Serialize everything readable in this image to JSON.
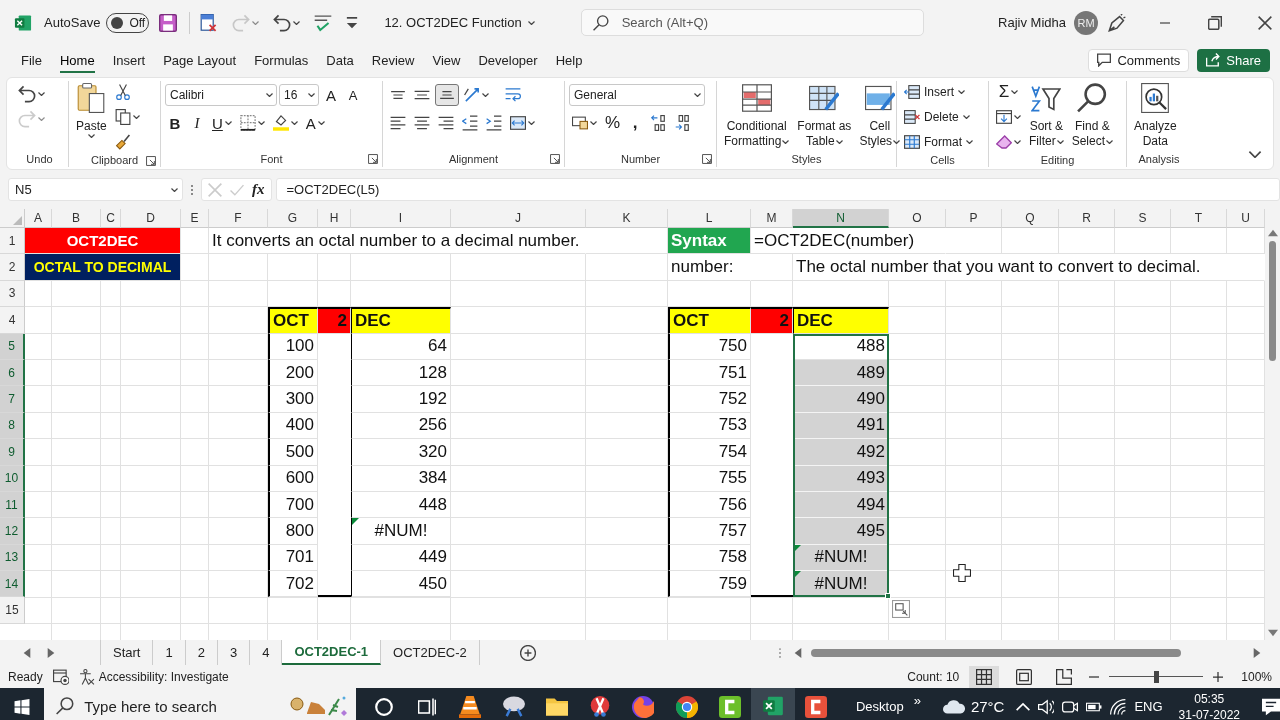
{
  "title_bar": {
    "autosave_label": "AutoSave",
    "autosave_state": "Off",
    "autosave_on": false,
    "file_name": "12. OCT2DEC Function",
    "search_placeholder": "Search (Alt+Q)",
    "user_name": "Rajiv Midha",
    "user_initials": "RM"
  },
  "menu_tabs": [
    {
      "label": "File",
      "selected": false
    },
    {
      "label": "Home",
      "selected": true
    },
    {
      "label": "Insert",
      "selected": false
    },
    {
      "label": "Page Layout",
      "selected": false
    },
    {
      "label": "Formulas",
      "selected": false
    },
    {
      "label": "Data",
      "selected": false
    },
    {
      "label": "Review",
      "selected": false
    },
    {
      "label": "View",
      "selected": false
    },
    {
      "label": "Developer",
      "selected": false
    },
    {
      "label": "Help",
      "selected": false
    }
  ],
  "comments_button": "Comments",
  "share_button": "Share",
  "ribbon": {
    "paste": "Paste",
    "font_name": "Calibri",
    "font_size": "16",
    "grow_font": "A",
    "shrink_font": "A",
    "bold": "B",
    "italic": "I",
    "underline": "U",
    "font_color": "A",
    "number_format": "General",
    "percent": "%",
    "comma": ",",
    "conditional_formatting": [
      "Conditional",
      "Formatting"
    ],
    "format_as_table": [
      "Format as",
      "Table"
    ],
    "cell_styles": [
      "Cell",
      "Styles"
    ],
    "insert": "Insert",
    "delete": "Delete",
    "format": "Format",
    "autosum": "Σ",
    "sort_filter": [
      "Sort &",
      "Filter"
    ],
    "find_select": [
      "Find &",
      "Select"
    ],
    "analyze_data": [
      "Analyze",
      "Data"
    ],
    "groups": [
      "Undo",
      "Clipboard",
      "Font",
      "Alignment",
      "Number",
      "Styles",
      "Cells",
      "Editing",
      "Analysis"
    ]
  },
  "formula_bar": {
    "name_box": "N5",
    "function_label": "fx",
    "formula": "=OCT2DEC(L5)"
  },
  "sheet": {
    "columns": [
      "A",
      "B",
      "C",
      "D",
      "E",
      "F",
      "G",
      "H",
      "I",
      "J",
      "K",
      "L",
      "M",
      "N",
      "O",
      "P",
      "Q",
      "R",
      "S",
      "T",
      "U"
    ],
    "rows": [
      "1",
      "2",
      "3",
      "4",
      "5",
      "6",
      "7",
      "8",
      "9",
      "10",
      "11",
      "12",
      "13",
      "14",
      "15"
    ],
    "title": {
      "name": "OCT2DEC",
      "subtitle": "OCTAL TO DECIMAL"
    },
    "description": "It converts an octal number to a decimal number.",
    "syntax": {
      "label": "Syntax",
      "formula": "=OCT2DEC(number)",
      "argument": "number:",
      "argument_description": "The octal number that you want to convert to decimal."
    },
    "tables": [
      {
        "headers": [
          {
            "text": "OCT",
            "color": "#ffff00"
          },
          {
            "text": "2",
            "color": "#ff0000"
          },
          {
            "text": "DEC",
            "color": "#ffff00"
          }
        ],
        "rows": [
          {
            "octal": "100",
            "decimal": "64",
            "error": false,
            "selected": false
          },
          {
            "octal": "200",
            "decimal": "128",
            "error": false,
            "selected": false
          },
          {
            "octal": "300",
            "decimal": "192",
            "error": false,
            "selected": false
          },
          {
            "octal": "400",
            "decimal": "256",
            "error": false,
            "selected": false
          },
          {
            "octal": "500",
            "decimal": "320",
            "error": false,
            "selected": false
          },
          {
            "octal": "600",
            "decimal": "384",
            "error": false,
            "selected": false
          },
          {
            "octal": "700",
            "decimal": "448",
            "error": false,
            "selected": false
          },
          {
            "octal": "800",
            "decimal": "#NUM!",
            "error": true,
            "selected": false
          },
          {
            "octal": "701",
            "decimal": "449",
            "error": false,
            "selected": false
          },
          {
            "octal": "702",
            "decimal": "450",
            "error": false,
            "selected": false
          }
        ]
      },
      {
        "headers": [
          {
            "text": "OCT",
            "color": "#ffff00"
          },
          {
            "text": "2",
            "color": "#ff0000"
          },
          {
            "text": "DEC",
            "color": "#ffff00"
          }
        ],
        "rows": [
          {
            "octal": "750",
            "decimal": "488",
            "error": false,
            "selected": true
          },
          {
            "octal": "751",
            "decimal": "489",
            "error": false,
            "selected": true
          },
          {
            "octal": "752",
            "decimal": "490",
            "error": false,
            "selected": true
          },
          {
            "octal": "753",
            "decimal": "491",
            "error": false,
            "selected": true
          },
          {
            "octal": "754",
            "decimal": "492",
            "error": false,
            "selected": true
          },
          {
            "octal": "755",
            "decimal": "493",
            "error": false,
            "selected": true
          },
          {
            "octal": "756",
            "decimal": "494",
            "error": false,
            "selected": true
          },
          {
            "octal": "757",
            "decimal": "495",
            "error": false,
            "selected": true
          },
          {
            "octal": "758",
            "decimal": "#NUM!",
            "error": true,
            "selected": true
          },
          {
            "octal": "759",
            "decimal": "#NUM!",
            "error": true,
            "selected": true
          }
        ]
      }
    ]
  },
  "sheet_tabs": [
    {
      "label": "Start",
      "selected": false
    },
    {
      "label": "1",
      "selected": false
    },
    {
      "label": "2",
      "selected": false
    },
    {
      "label": "3",
      "selected": false
    },
    {
      "label": "4",
      "selected": false
    },
    {
      "label": "OCT2DEC-1",
      "selected": true
    },
    {
      "label": "OCT2DEC-2",
      "selected": false
    }
  ],
  "status_bar": {
    "state": "Ready",
    "accessibility": "Accessibility: Investigate",
    "count": "Count: 10",
    "zoom": {
      "level": 0.5
    },
    "zoom_reading": "100%"
  },
  "taskbar": {
    "search_placeholder": "Type here to search",
    "desktop": "Desktop",
    "desktop_more": "»",
    "temperature": "27°C",
    "language": "ENG",
    "time": "05:35",
    "date": "31-07-2022"
  }
}
